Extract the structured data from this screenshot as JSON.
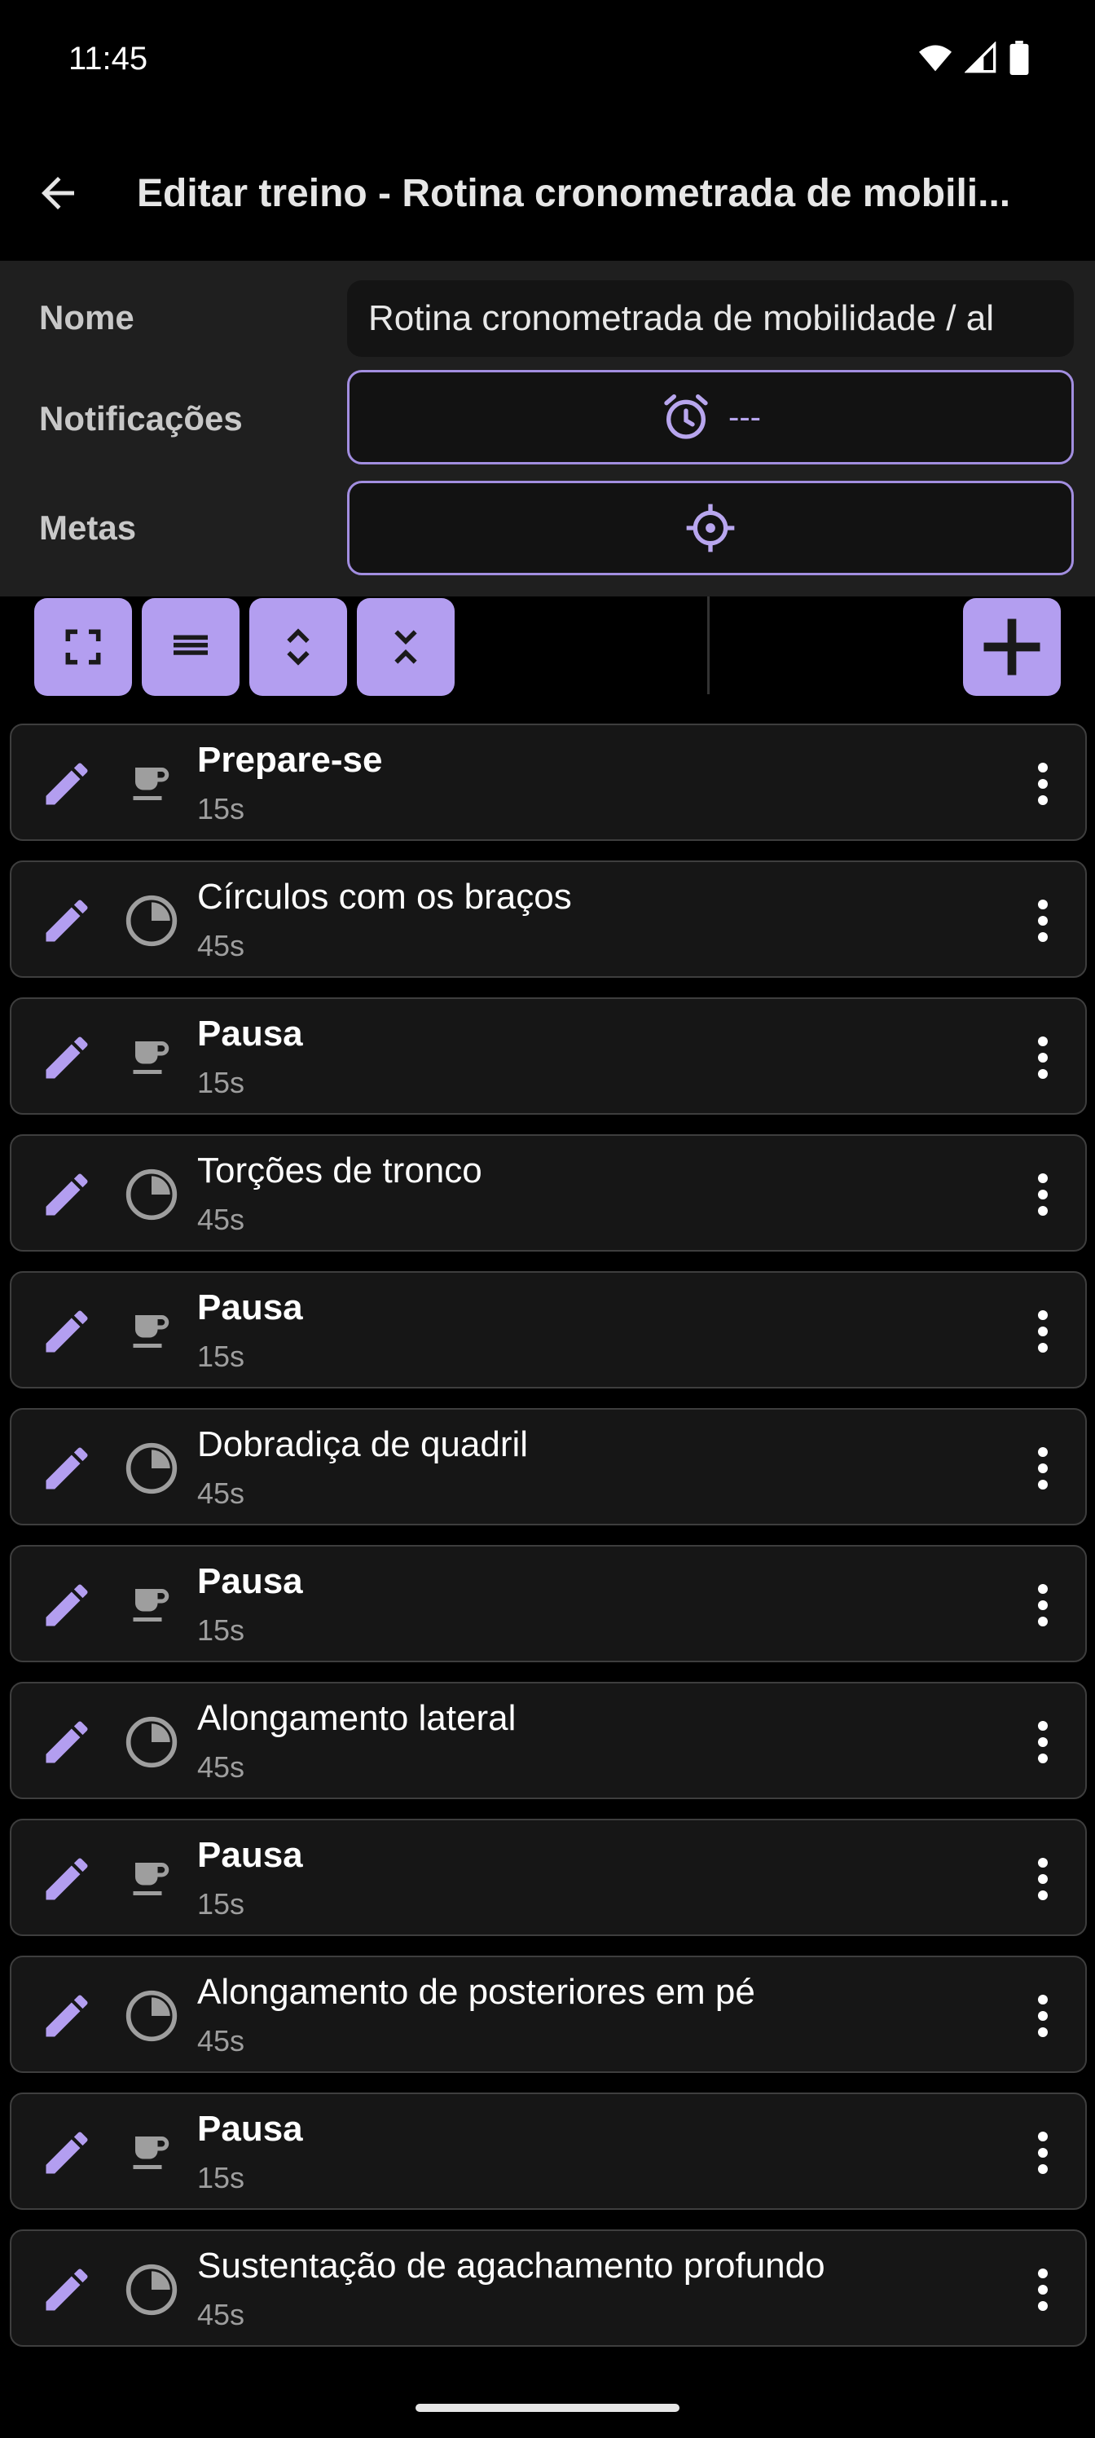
{
  "status": {
    "time": "11:45"
  },
  "app_bar": {
    "title": "Editar treino - Rotina cronometrada de mobili..."
  },
  "form": {
    "name_label": "Nome",
    "name_value": "Rotina cronometrada de mobilidade / al",
    "notifications_label": "Notificações",
    "notifications_value": "---",
    "goals_label": "Metas"
  },
  "toolbar": {
    "buttons": [
      "expand-icon",
      "list-icon",
      "expand-all-icon",
      "collapse-all-icon",
      "add-icon"
    ]
  },
  "colors": {
    "accent": "#b39ef0",
    "accent_outline": "#a28ee0",
    "background": "#000000",
    "card": "#161616"
  },
  "list": {
    "items": [
      {
        "title": "Prepare-se",
        "duration": "15s",
        "kind": "rest",
        "icon": "coffee-icon"
      },
      {
        "title": "Círculos com os braços",
        "duration": "45s",
        "kind": "timed",
        "icon": "timer-pie-icon"
      },
      {
        "title": "Pausa",
        "duration": "15s",
        "kind": "rest",
        "icon": "coffee-icon"
      },
      {
        "title": "Torções de tronco",
        "duration": "45s",
        "kind": "timed",
        "icon": "timer-pie-icon"
      },
      {
        "title": "Pausa",
        "duration": "15s",
        "kind": "rest",
        "icon": "coffee-icon"
      },
      {
        "title": "Dobradiça de quadril",
        "duration": "45s",
        "kind": "timed",
        "icon": "timer-pie-icon"
      },
      {
        "title": "Pausa",
        "duration": "15s",
        "kind": "rest",
        "icon": "coffee-icon"
      },
      {
        "title": "Alongamento lateral",
        "duration": "45s",
        "kind": "timed",
        "icon": "timer-pie-icon"
      },
      {
        "title": "Pausa",
        "duration": "15s",
        "kind": "rest",
        "icon": "coffee-icon"
      },
      {
        "title": "Alongamento de posteriores em pé",
        "duration": "45s",
        "kind": "timed",
        "icon": "timer-pie-icon"
      },
      {
        "title": "Pausa",
        "duration": "15s",
        "kind": "rest",
        "icon": "coffee-icon"
      },
      {
        "title": "Sustentação de agachamento profundo",
        "duration": "45s",
        "kind": "timed",
        "icon": "timer-pie-icon"
      }
    ]
  }
}
